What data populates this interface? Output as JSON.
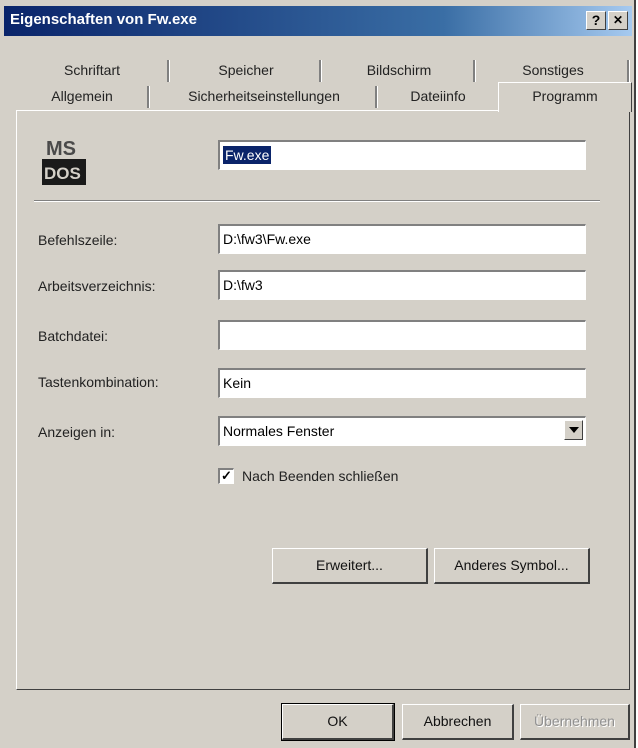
{
  "window": {
    "title": "Eigenschaften von Fw.exe",
    "help_button": "?",
    "close_button": "✕"
  },
  "tabs_back": [
    "Schriftart",
    "Speicher",
    "Bildschirm",
    "Sonstiges"
  ],
  "tabs_front": [
    "Allgemein",
    "Sicherheitseinstellungen",
    "Dateiinfo"
  ],
  "active_tab": "Programm",
  "program": {
    "icon_label_top": "MS",
    "icon_label_bottom": "DOS",
    "name_value": "Fw.exe"
  },
  "fields": {
    "befehlszeile_label": "Befehlszeile:",
    "befehlszeile_value": "D:\\fw3\\Fw.exe",
    "arbeitsverzeichnis_label": "Arbeitsverzeichnis:",
    "arbeitsverzeichnis_value": "D:\\fw3",
    "batchdatei_label": "Batchdatei:",
    "batchdatei_value": "",
    "tastenkombination_label": "Tastenkombination:",
    "tastenkombination_value": "Kein",
    "anzeigen_label": "Anzeigen in:",
    "anzeigen_value": "Normales Fenster"
  },
  "checkbox": {
    "label": "Nach Beenden schließen",
    "checked": true,
    "mark": "✓"
  },
  "buttons": {
    "erweitert": "Erweitert...",
    "anderes_symbol": "Anderes Symbol...",
    "ok": "OK",
    "abbrechen": "Abbrechen",
    "uebernehmen": "Übernehmen"
  }
}
